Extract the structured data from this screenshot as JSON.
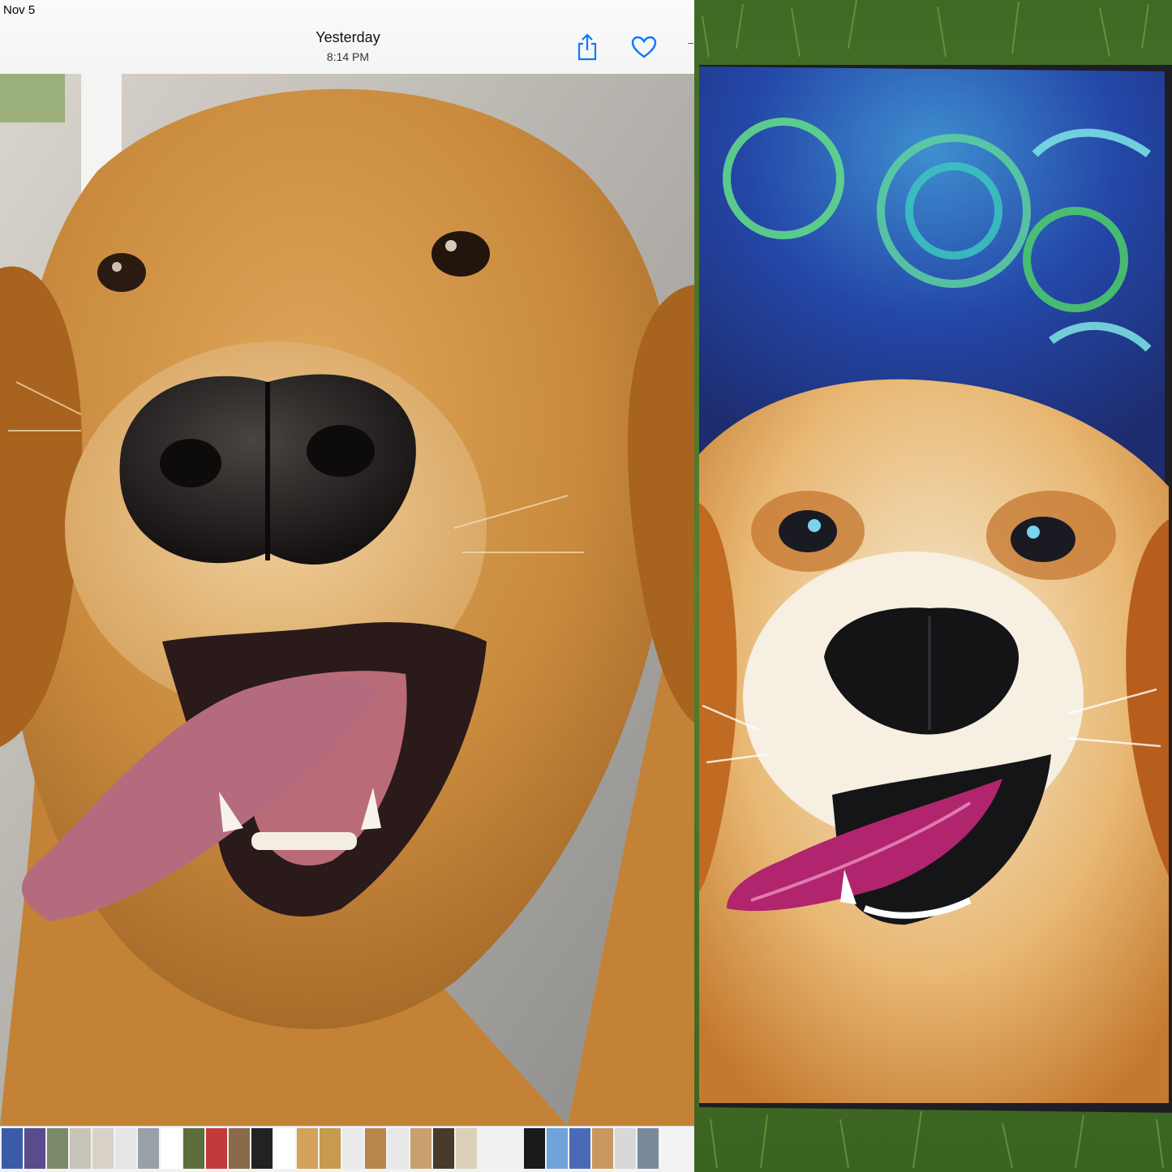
{
  "status_bar": {
    "date": "Nov 5"
  },
  "nav": {
    "title": "Yesterday",
    "subtitle": "8:14 PM",
    "share_icon": "share-icon",
    "favorite_icon": "heart-icon"
  },
  "photo": {
    "subject": "golden retriever photo"
  },
  "painting": {
    "subject": "golden retriever painting"
  },
  "thumbnails": {
    "colors": [
      "#3b5aa8",
      "#5a4b8c",
      "#7a8a6b",
      "#c9c4b8",
      "#d8d2c8",
      "#e6e6e6",
      "#9aa0a8",
      "#ffffff",
      "#5c6f3a",
      "#c23b3b",
      "#8a6a4a",
      "#222222",
      "#ffffff",
      "#d4a25a",
      "#c79a52",
      "#eaeaea",
      "#b9864a",
      "#e8e8e8",
      "#c8a070",
      "#4a3a2a",
      "#ddd0b8",
      "#f1f1f1",
      "#f0f0f0",
      "#1a1a1a",
      "#6fa2d8",
      "#4a6ab8",
      "#c89860",
      "#d8d8d8",
      "#7a8a9a",
      "#f3f3f3"
    ]
  },
  "colors": {
    "ios_blue": "#0a7aff",
    "fur": "#c88a3c",
    "nose": "#1f1b1a",
    "tongue": "#b86a7c",
    "canvas_bg": "#2242a6",
    "grass": "#4e7a2c"
  }
}
